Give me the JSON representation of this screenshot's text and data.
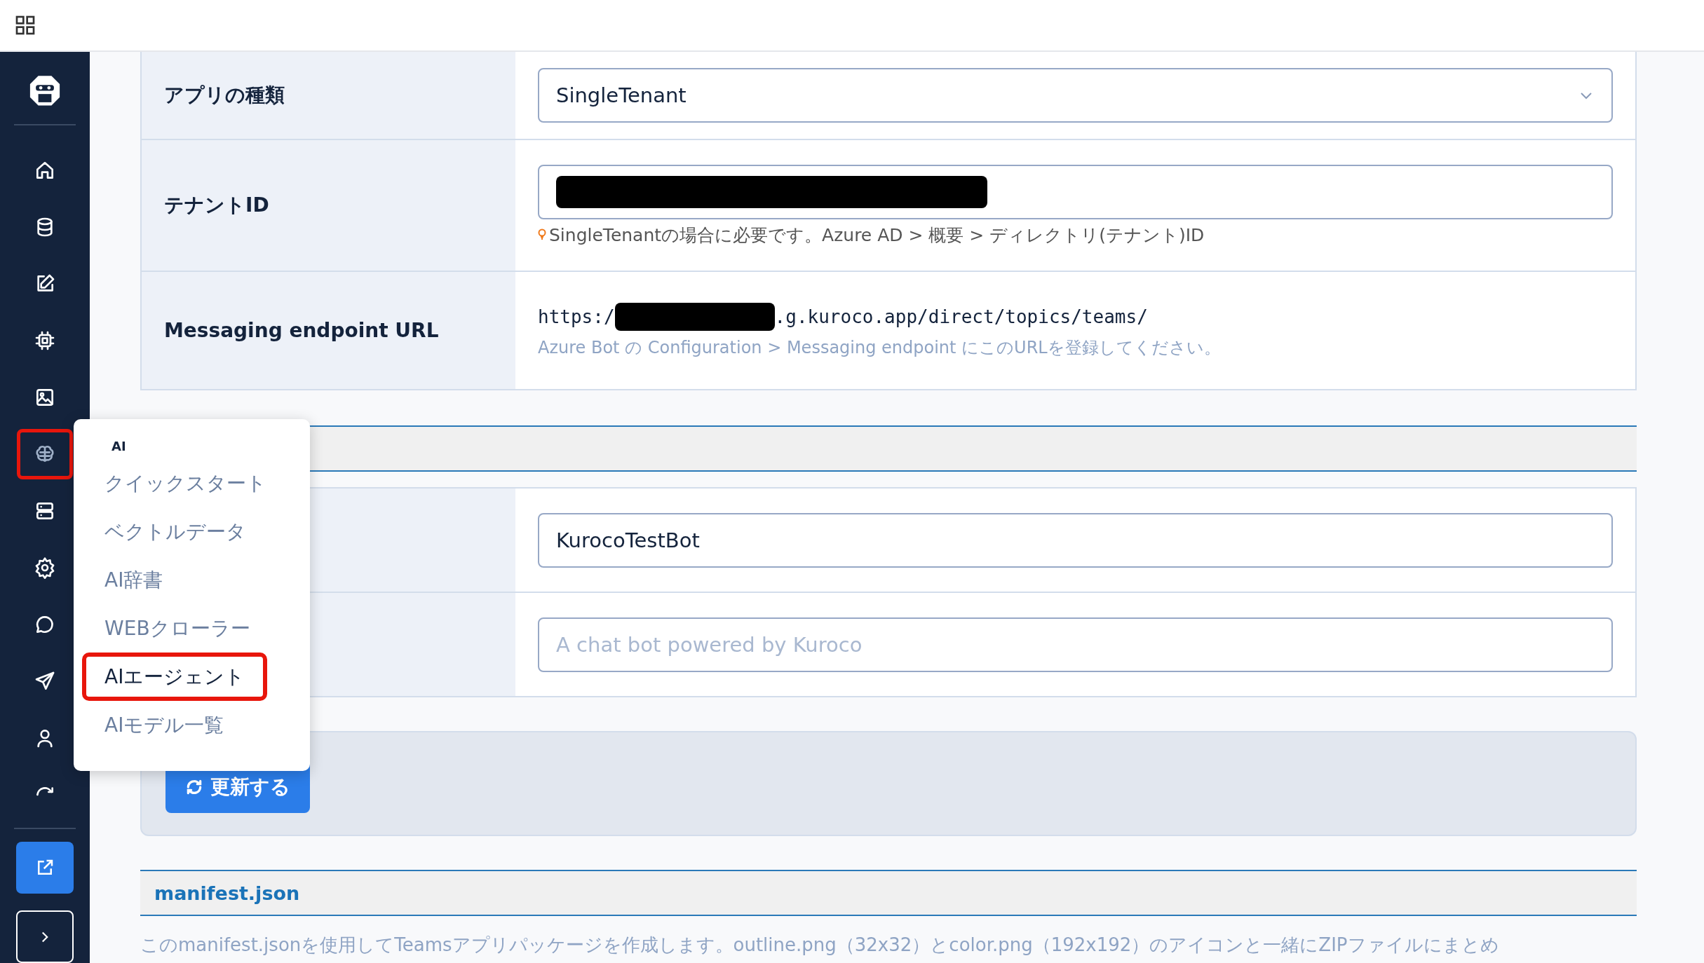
{
  "sidebar": {
    "items": [
      {
        "kind": "home",
        "selected": false,
        "highlighted": false
      },
      {
        "kind": "database",
        "selected": false,
        "highlighted": false
      },
      {
        "kind": "edit",
        "selected": false,
        "highlighted": false
      },
      {
        "kind": "chip",
        "selected": false,
        "highlighted": false
      },
      {
        "kind": "image",
        "selected": false,
        "highlighted": false
      },
      {
        "kind": "brain",
        "selected": true,
        "highlighted": true
      },
      {
        "kind": "server",
        "selected": false,
        "highlighted": false
      },
      {
        "kind": "gear",
        "selected": false,
        "highlighted": false
      },
      {
        "kind": "chat",
        "selected": false,
        "highlighted": false
      },
      {
        "kind": "send",
        "selected": false,
        "highlighted": false
      },
      {
        "kind": "user",
        "selected": false,
        "highlighted": false
      },
      {
        "kind": "refresh",
        "selected": false,
        "highlighted": false
      }
    ]
  },
  "settings": {
    "rows": [
      {
        "kind": "select",
        "label": "アプリの種類",
        "value": "SingleTenant"
      },
      {
        "kind": "redacted",
        "label": "テナントID",
        "hint": "SingleTenantの場合に必要です。Azure AD > 概要 > ディレクトリ(テナント)ID"
      },
      {
        "kind": "url",
        "label": "Messaging endpoint URL",
        "prefix": "https:/",
        "suffix": ".g.kuroco.app/direct/topics/teams/",
        "note": "Azure Bot の Configuration > Messaging endpoint にこのURLを登録してください。"
      }
    ]
  },
  "bot": {
    "rows": [
      {
        "kind": "input",
        "value": "KurocoTestBot"
      },
      {
        "kind": "input",
        "placeholder": "A chat bot powered by Kuroco"
      }
    ]
  },
  "update_button": "更新する",
  "manifest": {
    "title": "manifest.json",
    "text": "このmanifest.jsonを使用してTeamsアプリパッケージを作成します。outline.png（32x32）とcolor.png（192x192）のアイコンと一緒にZIPファイルにまとめ"
  },
  "menu": {
    "title": "AI",
    "items": [
      {
        "label": "クイックスタート",
        "selected": false,
        "highlighted": false
      },
      {
        "label": "ベクトルデータ",
        "selected": false,
        "highlighted": false
      },
      {
        "label": "AI辞書",
        "selected": false,
        "highlighted": false
      },
      {
        "label": "WEBクローラー",
        "selected": false,
        "highlighted": false
      },
      {
        "label": "AIエージェント",
        "selected": true,
        "highlighted": true
      },
      {
        "label": "AIモデル一覧",
        "selected": false,
        "highlighted": false
      }
    ]
  }
}
